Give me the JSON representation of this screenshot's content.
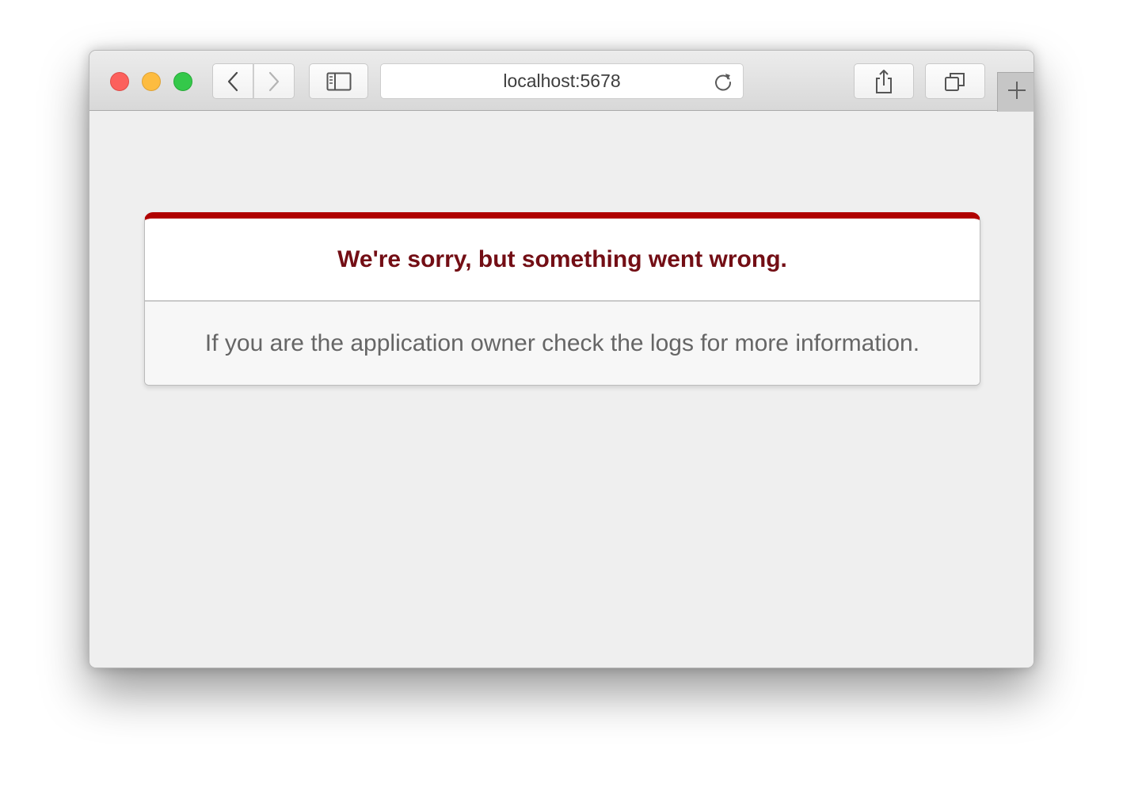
{
  "browser": {
    "address_url": "localhost:5678",
    "icons": {
      "back": "chevron-left-icon",
      "forward": "chevron-right-icon",
      "sidebar": "sidebar-icon",
      "reload": "reload-icon",
      "share": "share-icon",
      "tabs": "tab-overview-icon",
      "new_tab": "plus-icon"
    },
    "colors": {
      "close": "#fc605c",
      "minimize": "#fdbc40",
      "zoom": "#34c84a"
    }
  },
  "error": {
    "title": "We're sorry, but something went wrong.",
    "message": "If you are the application owner check the logs for more information.",
    "accent_color": "#b00100",
    "title_color": "#730e15"
  }
}
